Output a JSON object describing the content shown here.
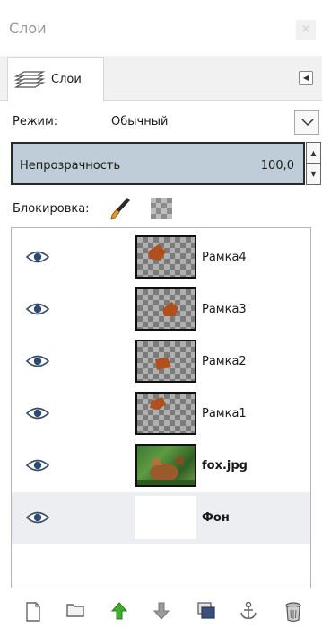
{
  "window": {
    "title": "Слои",
    "close_glyph": "×"
  },
  "tab": {
    "label": "Слои",
    "icon": "layers-icon",
    "menu_icon": "tab-menu-icon"
  },
  "mode": {
    "label": "Режим:",
    "value": "Обычный"
  },
  "opacity": {
    "label": "Непрозрачность",
    "value": "100,0"
  },
  "lock": {
    "label": "Блокировка:",
    "icons": [
      "brush-lock-icon",
      "alpha-lock-icon"
    ]
  },
  "layers": [
    {
      "name": "Рамка4",
      "bold": false,
      "visible": true,
      "thumb": "checker"
    },
    {
      "name": "Рамка3",
      "bold": false,
      "visible": true,
      "thumb": "checker"
    },
    {
      "name": "Рамка2",
      "bold": false,
      "visible": true,
      "thumb": "checker"
    },
    {
      "name": "Рамка1",
      "bold": false,
      "visible": true,
      "thumb": "checker"
    },
    {
      "name": "fox.jpg",
      "bold": true,
      "visible": true,
      "thumb": "photo"
    },
    {
      "name": "Фон",
      "bold": true,
      "visible": true,
      "thumb": "white",
      "selected": true
    }
  ],
  "toolbar": [
    "new-layer-icon",
    "new-group-icon",
    "raise-layer-icon",
    "lower-layer-icon",
    "duplicate-layer-icon",
    "anchor-layer-icon",
    "delete-layer-icon"
  ],
  "colors": {
    "opacity_bar": "#bfcdd9",
    "raise_arrow": "#3fae2a",
    "lower_arrow": "#9a9a9a",
    "splotch": "#b0501f",
    "selected_row": "#eceef1"
  }
}
